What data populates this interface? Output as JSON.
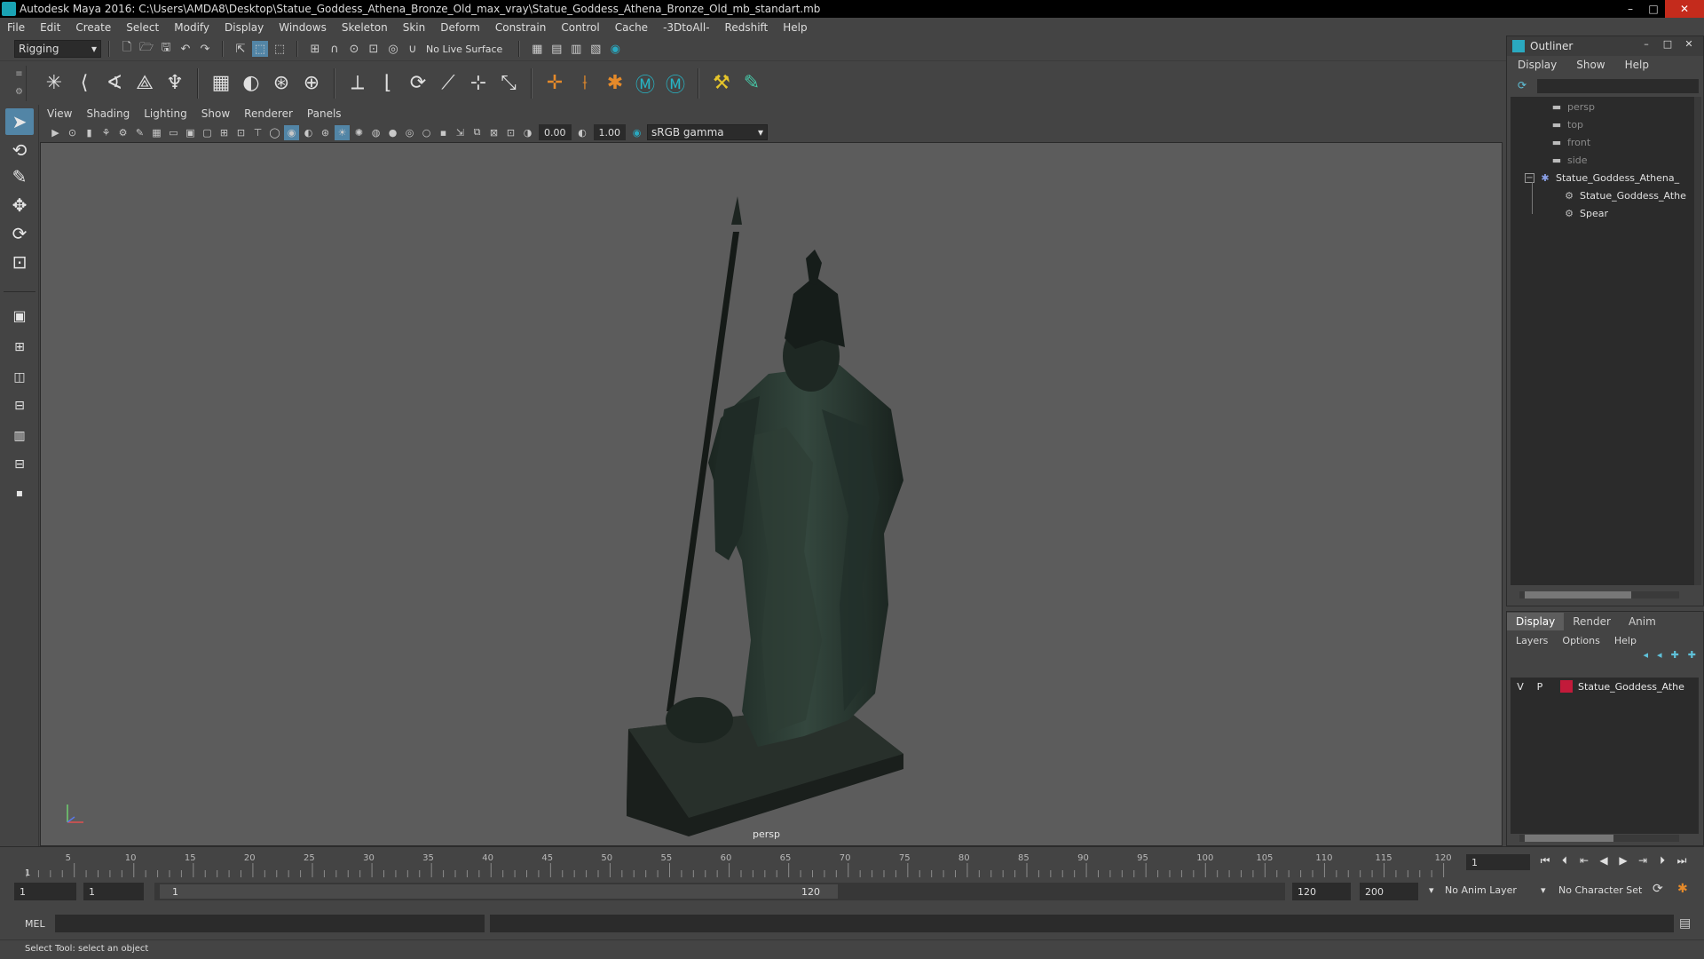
{
  "window": {
    "title": "Autodesk Maya 2016: C:\\Users\\AMDA8\\Desktop\\Statue_Goddess_Athena_Bronze_Old_max_vray\\Statue_Goddess_Athena_Bronze_Old_mb_standart.mb",
    "controls": {
      "minimize": "–",
      "maximize": "□",
      "close": "✕"
    }
  },
  "menubar": [
    "File",
    "Edit",
    "Create",
    "Select",
    "Modify",
    "Display",
    "Windows",
    "Skeleton",
    "Skin",
    "Deform",
    "Constrain",
    "Control",
    "Cache",
    "-3DtoAll-",
    "Redshift",
    "Help"
  ],
  "statusline": {
    "menuset": "Rigging",
    "live_surface": "No Live Surface"
  },
  "viewport": {
    "menu": [
      "View",
      "Shading",
      "Lighting",
      "Show",
      "Renderer",
      "Panels"
    ],
    "exposure": "0.00",
    "gamma": "1.00",
    "color_space": "sRGB gamma",
    "camera_label": "persp",
    "axis_labels": {
      "x": "x",
      "y": "y",
      "z": "z"
    }
  },
  "outliner": {
    "title": "Outliner",
    "menu": [
      "Display",
      "Show",
      "Help"
    ],
    "items": [
      {
        "label": "persp",
        "icon": "camera-icon",
        "dim": true
      },
      {
        "label": "top",
        "icon": "camera-icon",
        "dim": true
      },
      {
        "label": "front",
        "icon": "camera-icon",
        "dim": true
      },
      {
        "label": "side",
        "icon": "camera-icon",
        "dim": true
      },
      {
        "label": "Statue_Goddess_Athena_",
        "icon": "group-icon",
        "dim": false
      },
      {
        "label": "Statue_Goddess_Athe",
        "icon": "mesh-icon",
        "dim": false
      },
      {
        "label": "Spear",
        "icon": "mesh-icon",
        "dim": false
      }
    ]
  },
  "layer_editor": {
    "tabs": [
      "Display",
      "Render",
      "Anim"
    ],
    "active_tab": "Display",
    "menu": [
      "Layers",
      "Options",
      "Help"
    ],
    "layers": [
      {
        "v": "V",
        "p": "P",
        "name": "Statue_Goddess_Athe",
        "color": "#c21a3a"
      }
    ]
  },
  "timeline": {
    "ticks": [
      "5",
      "10",
      "15",
      "20",
      "25",
      "30",
      "35",
      "40",
      "45",
      "50",
      "55",
      "60",
      "65",
      "70",
      "75",
      "80",
      "85",
      "90",
      "95",
      "100",
      "105",
      "110",
      "115",
      "120"
    ],
    "start_label": "1",
    "current_frame": "1"
  },
  "range": {
    "start_field": "1",
    "playback_start": "1",
    "inner_start": "1",
    "inner_end": "120",
    "playback_end": "120",
    "end_field": "200",
    "anim_layer": "No Anim Layer",
    "character_set": "No Character Set"
  },
  "cmdline": {
    "label": "MEL"
  },
  "helpline": {
    "text": "Select Tool: select an object"
  },
  "colors": {
    "accent": "#5285a6",
    "maya_teal": "#1aa3b4",
    "layer_red": "#c21a3a",
    "viewport_bg": "#5c5c5c"
  }
}
